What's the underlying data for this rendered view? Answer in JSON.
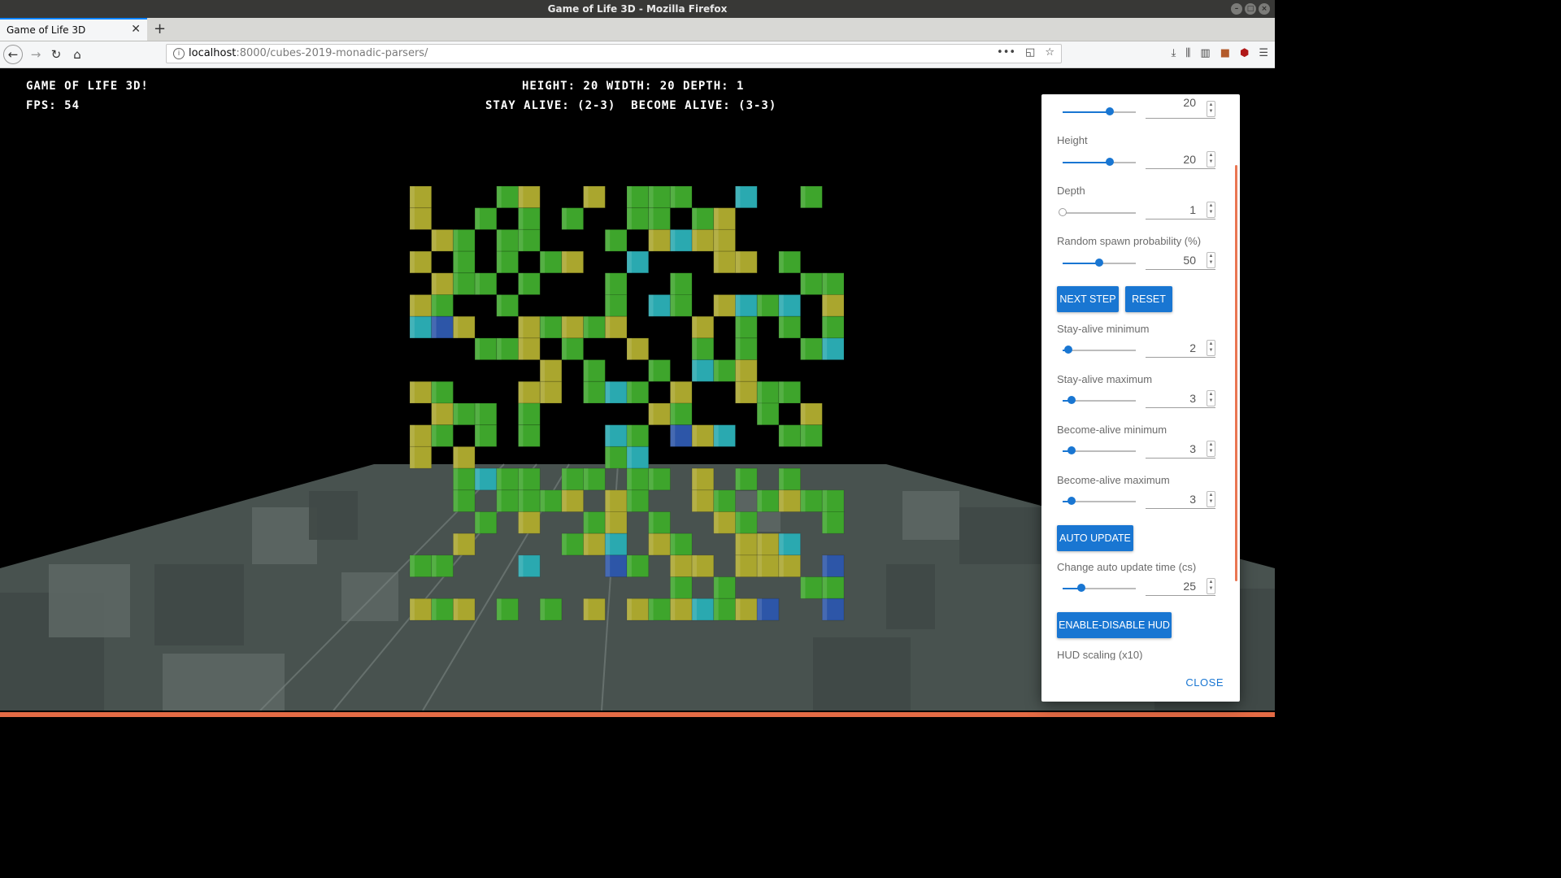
{
  "window": {
    "title": "Game of Life 3D - Mozilla Firefox"
  },
  "tab": {
    "title": "Game of Life 3D"
  },
  "url": {
    "host": "localhost",
    "rest": ":8000/cubes-2019-monadic-parsers/"
  },
  "hud": {
    "title": "Game of Life 3D!",
    "fps": "FPS: 54",
    "dimensions": "Height: 20 Width: 20 Depth: 1",
    "rules": "Stay alive: (2-3)  Become alive: (3-3)"
  },
  "icons": {
    "back": "back-arrow-icon",
    "forward": "forward-arrow-icon",
    "reload": "reload-icon",
    "home": "home-icon",
    "info": "site-info-icon",
    "more": "more-actions-icon",
    "pocket": "pocket-icon",
    "bookmark": "bookmark-star-icon",
    "download": "download-icon",
    "library": "library-icon",
    "sidebar": "sidebar-icon",
    "menu": "hamburger-menu-icon"
  },
  "panel": {
    "width_row": {
      "value": "20",
      "level": 0.64
    },
    "height": {
      "label": "Height",
      "value": "20",
      "level": 0.64
    },
    "depth": {
      "label": "Depth",
      "value": "1",
      "level": 0.0
    },
    "spawn": {
      "label": "Random spawn probability (%)",
      "value": "50",
      "level": 0.5
    },
    "next_step": "Next Step",
    "reset": "Reset",
    "stay_min": {
      "label": "Stay-alive minimum",
      "value": "2",
      "level": 0.08
    },
    "stay_max": {
      "label": "Stay-alive maximum",
      "value": "3",
      "level": 0.12
    },
    "become_min": {
      "label": "Become-alive minimum",
      "value": "3",
      "level": 0.12
    },
    "become_max": {
      "label": "Become-alive maximum",
      "value": "3",
      "level": 0.12
    },
    "auto_update": "Auto Update",
    "auto_time": {
      "label": "Change auto update time (cs)",
      "value": "25",
      "level": 0.25
    },
    "hud_toggle": "Enable-Disable HUD",
    "hud_scaling": {
      "label": "HUD scaling (x10)"
    },
    "close": "Close"
  },
  "colors": {
    "accent": "#1976d2",
    "green": "#3ea52c",
    "yellow": "#aaa62e",
    "cyan": "#2aa9b0",
    "blue": "#2d56a8",
    "floor": "#48524f",
    "scroll": "#ea7652"
  }
}
